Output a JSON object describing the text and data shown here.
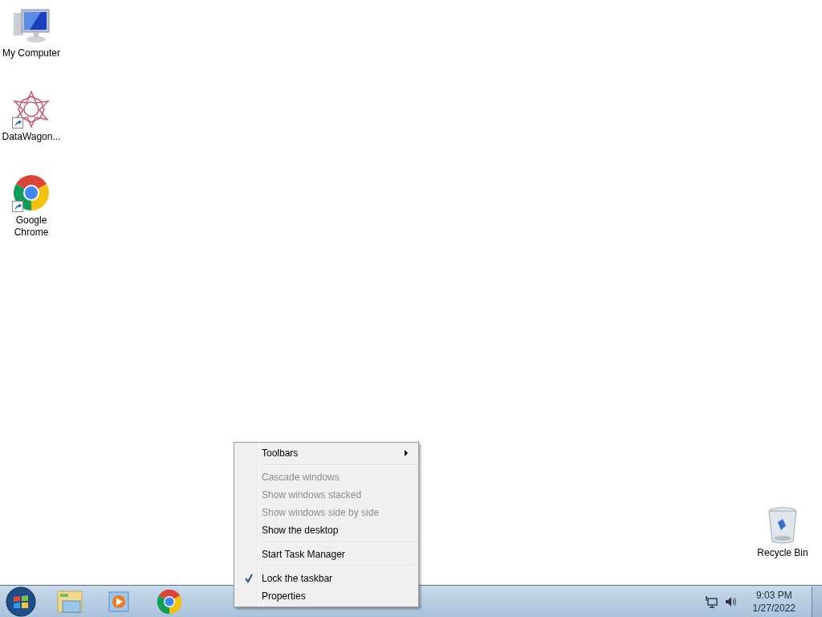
{
  "desktop_icons": [
    {
      "label": "My Computer",
      "kind": "computer",
      "shortcut": false
    },
    {
      "label": "DataWagon...",
      "kind": "star",
      "shortcut": true
    },
    {
      "label": "Google Chrome",
      "kind": "chrome",
      "shortcut": true
    },
    {
      "label": "Recycle Bin",
      "kind": "bin",
      "shortcut": false
    }
  ],
  "context_menu": {
    "groups": [
      [
        {
          "label": "Toolbars",
          "submenu": true,
          "disabled": false,
          "checked": false
        }
      ],
      [
        {
          "label": "Cascade windows",
          "submenu": false,
          "disabled": true,
          "checked": false
        },
        {
          "label": "Show windows stacked",
          "submenu": false,
          "disabled": true,
          "checked": false
        },
        {
          "label": "Show windows side by side",
          "submenu": false,
          "disabled": true,
          "checked": false
        },
        {
          "label": "Show the desktop",
          "submenu": false,
          "disabled": false,
          "checked": false
        }
      ],
      [
        {
          "label": "Start Task Manager",
          "submenu": false,
          "disabled": false,
          "checked": false
        }
      ],
      [
        {
          "label": "Lock the taskbar",
          "submenu": false,
          "disabled": false,
          "checked": true
        },
        {
          "label": "Properties",
          "submenu": false,
          "disabled": false,
          "checked": false
        }
      ]
    ]
  },
  "taskbar": {
    "pinned": [
      {
        "kind": "explorer"
      },
      {
        "kind": "player"
      },
      {
        "kind": "chrome"
      }
    ],
    "clock": {
      "time": "9:03 PM",
      "date": "1/27/2022"
    }
  }
}
